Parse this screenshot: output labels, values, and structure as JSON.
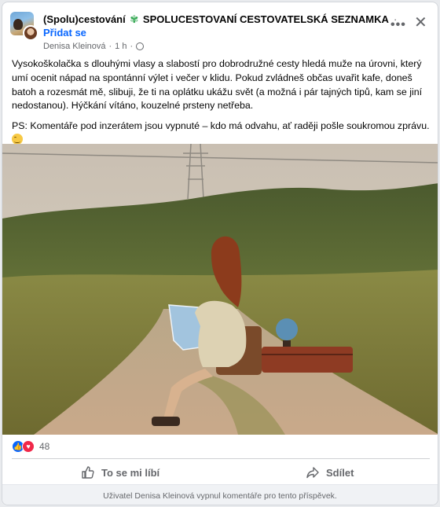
{
  "post": {
    "group_name": "(Spolu)cestování",
    "group_title": "SPOLUCESTOVANÍ CESTOVATELSKÁ SEZNAMKA",
    "title_dot": "·",
    "join_label": "Přidat se",
    "author": "Denisa Kleinová",
    "time": "1 h",
    "separator": "·",
    "more_icon": "more-horizontal-icon",
    "close_icon": "close-icon",
    "paragraph_1": "Vysokoškolačka s dlouhými vlasy a slabostí pro dobrodružné cesty hledá muže na úrovni, který umí ocenit nápad na spontánní výlet i večer v klidu. Pokud zvládneš občas uvařit kafe, doneš batoh a rozesmát mě, slibuji, že ti na oplátku ukážu svět (a možná i pár tajných tipů, kam se jiní nedostanou). Hýčkání vítáno, kouzelné prsteny netřeba.",
    "paragraph_2": "PS: Komentáře pod inzerátem jsou vypnuté – kdo má odvahu, ať raději pošle soukromou zprávu.",
    "emoji": "wink-emoji"
  },
  "reactions": {
    "count": "48",
    "types": [
      "like",
      "love"
    ]
  },
  "actions": {
    "like_label": "To se mi líbí",
    "share_label": "Sdílet"
  },
  "footer": {
    "notice": "Uživatel Denisa Kleinová vypnul komentáře pro tento příspěvek."
  },
  "colors": {
    "accent": "#0866ff",
    "love": "#f02849",
    "muted": "#65676b",
    "footer_bg": "#f0f2f5"
  }
}
